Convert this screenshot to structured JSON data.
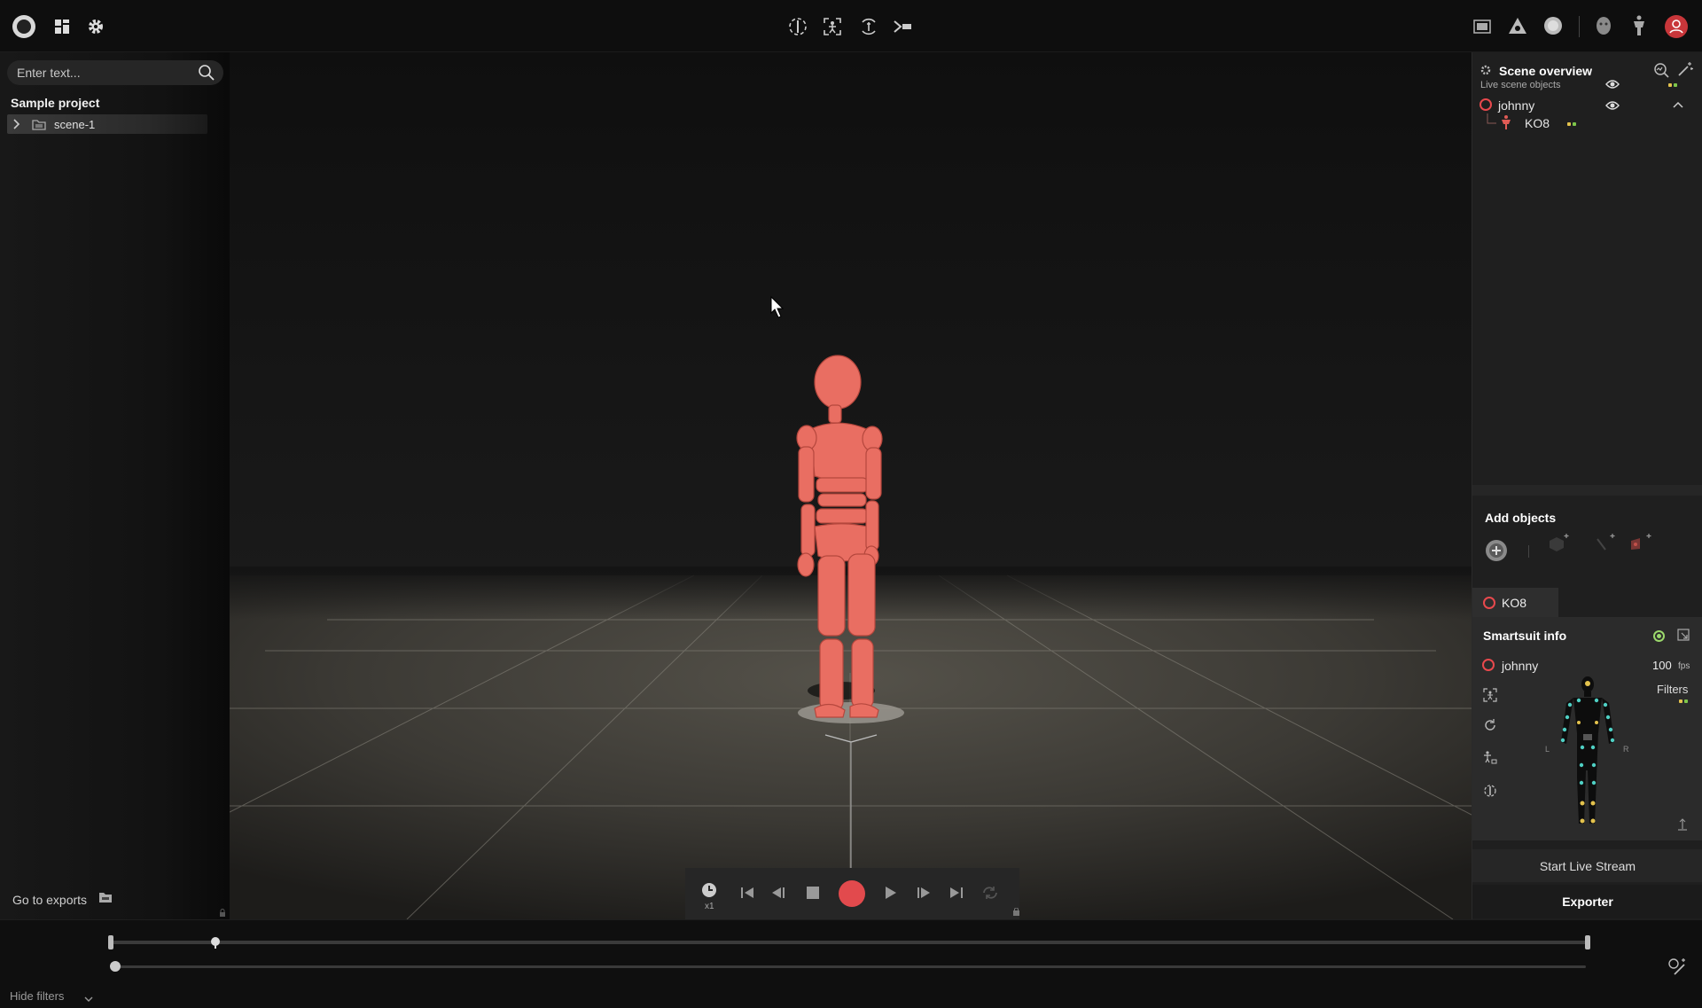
{
  "topbar": {
    "left_icons": [
      "app-logo-icon",
      "layout-grid-icon",
      "settings-gear-icon"
    ],
    "center_icons": [
      "mirror-icon",
      "calibrate-icon",
      "rotate-icon",
      "forward-icon"
    ],
    "right_icons": [
      "film-icon",
      "triangle-icon",
      "circle-icon",
      "face-icon",
      "body-icon",
      "user-profile-icon"
    ]
  },
  "left_panel": {
    "search_placeholder": "Enter text...",
    "project_title": "Sample project",
    "tree_items": [
      {
        "label": "scene-1"
      }
    ],
    "go_to_exports": "Go to exports"
  },
  "scene_overview": {
    "title": "Scene overview",
    "live_objects_label": "Live scene objects",
    "actor_name": "johnny",
    "device_name": "KO8"
  },
  "add_objects": {
    "title": "Add objects"
  },
  "device_tab": {
    "label": "KO8"
  },
  "smartsuit_info": {
    "title": "Smartsuit info",
    "actor_name": "johnny",
    "fps_value": "100",
    "fps_unit": "fps",
    "filters_label": "Filters",
    "left_marker": "L",
    "right_marker": "R",
    "start_stream_label": "Start Live Stream",
    "exporter_label": "Exporter"
  },
  "transport": {
    "speed_label": "x1",
    "record_color": "#e24a4d"
  },
  "timeline": {
    "playhead_fraction": 0.07,
    "hide_filters_label": "Hide filters"
  },
  "colors": {
    "accent_red": "#e8494d",
    "status_green": "#7ec64a",
    "status_yellow": "#e3c24d",
    "figure_color": "#e96e62"
  }
}
